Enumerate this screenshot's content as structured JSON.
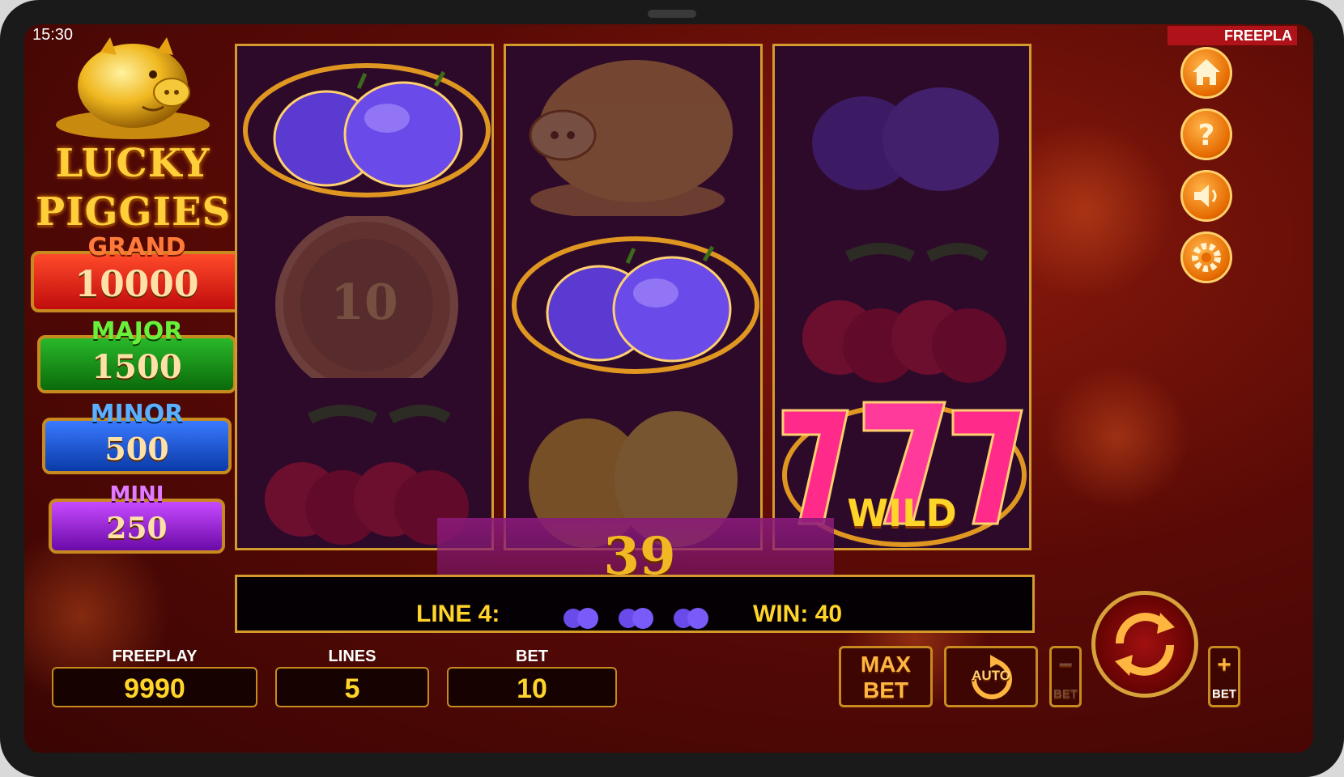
{
  "status_bar": {
    "time": "15:30",
    "mode_tag": "FREEPLA"
  },
  "logo": {
    "line1": "LUCKY",
    "line2": "PIGGIES"
  },
  "jackpots": [
    {
      "title": "GRAND",
      "value": "10000",
      "color": "#e02414",
      "title_color": "#ff6a2a"
    },
    {
      "title": "MAJOR",
      "value": "1500",
      "color": "#1a8a1a",
      "title_color": "#3bcf2a"
    },
    {
      "title": "MINOR",
      "value": "500",
      "color": "#1a52d0",
      "title_color": "#3a8aff"
    },
    {
      "title": "MINI",
      "value": "250",
      "color": "#8a1ac8",
      "title_color": "#c84aff"
    }
  ],
  "reels": [
    [
      "plums",
      "coin-10",
      "cherries"
    ],
    [
      "piggy-bank",
      "plums",
      "lemons"
    ],
    [
      "plums",
      "cherries",
      "wild-777"
    ]
  ],
  "symbol_text": {
    "coin_value": "10",
    "wild_label": "WILD"
  },
  "win_display": {
    "amount": "39",
    "line_label": "LINE 4:",
    "win_label": "WIN: 40"
  },
  "stats": {
    "freeplay": {
      "label": "FREEPLAY",
      "value": "9990"
    },
    "lines": {
      "label": "LINES",
      "value": "5"
    },
    "bet": {
      "label": "BET",
      "value": "10"
    }
  },
  "buttons": {
    "max_bet": [
      "MAX",
      "BET"
    ],
    "auto": "AUTO",
    "bet_minus": "BET",
    "bet_plus": "BET"
  },
  "colors": {
    "accent_gold": "#d49a2c",
    "text_gold": "#ffd52a",
    "background": "#5a0a06"
  }
}
